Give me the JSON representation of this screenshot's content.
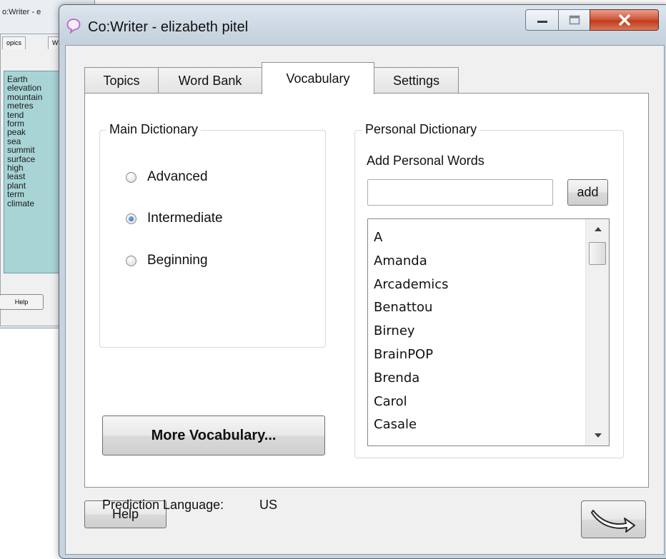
{
  "background_window": {
    "title": "o:Writer - e",
    "tabs": [
      "opics",
      "W"
    ],
    "words": [
      "Earth",
      "elevation",
      "mountain",
      "metres",
      "tend",
      "form",
      "peak",
      "sea",
      "summit",
      "surface",
      "high",
      "least",
      "plant",
      "term",
      "climate"
    ],
    "help_label": "Help"
  },
  "window": {
    "title": "Co:Writer - elizabeth pitel",
    "accent_color": "#c7d3df",
    "close_color": "#c03c1d"
  },
  "tabs": [
    {
      "label": "Topics",
      "active": false
    },
    {
      "label": "Word Bank",
      "active": false
    },
    {
      "label": "Vocabulary",
      "active": true
    },
    {
      "label": "Settings",
      "active": false
    }
  ],
  "main_dictionary": {
    "legend": "Main Dictionary",
    "options": [
      {
        "label": "Advanced",
        "checked": false
      },
      {
        "label": "Intermediate",
        "checked": true
      },
      {
        "label": "Beginning",
        "checked": false
      }
    ],
    "more_button": "More Vocabulary..."
  },
  "prediction": {
    "label": "Prediction Language:",
    "value": "US"
  },
  "personal_dictionary": {
    "legend": "Personal Dictionary",
    "add_label": "Add Personal Words",
    "input_value": "",
    "add_button": "add",
    "words": [
      "A",
      "Amanda",
      "Arcademics",
      "Benattou",
      "Birney",
      "BrainPOP",
      "Brenda",
      "Carol",
      "Casale"
    ]
  },
  "footer": {
    "help_button": "Help",
    "next_icon": "curved-arrow-right-icon"
  }
}
